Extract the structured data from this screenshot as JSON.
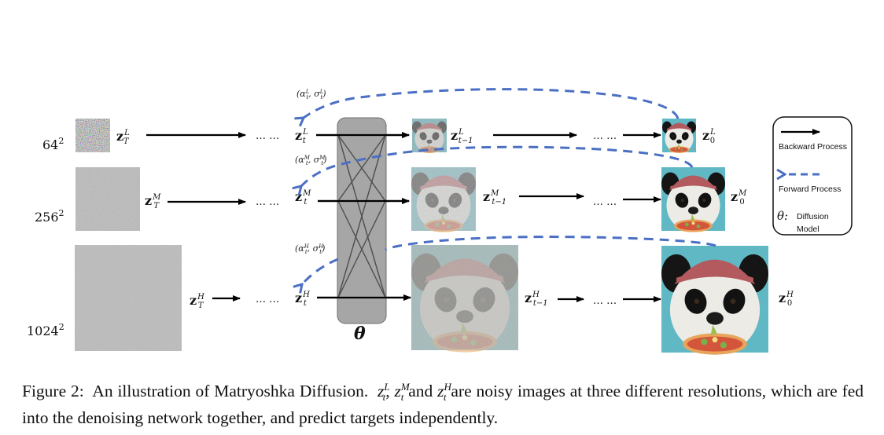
{
  "diagram": {
    "resolutions": [
      {
        "label_base": "64",
        "label_exp": "2",
        "level": "L"
      },
      {
        "label_base": "256",
        "label_exp": "2",
        "level": "M"
      },
      {
        "label_base": "1024",
        "label_exp": "2",
        "level": "H"
      }
    ],
    "rows": [
      {
        "level": "L",
        "z_T": {
          "base": "z",
          "sup": "L",
          "sub": "T"
        },
        "z_t": {
          "base": "z",
          "sup": "L",
          "sub": "t"
        },
        "z_t1": {
          "base": "z",
          "sup": "L",
          "sub": "t−1"
        },
        "z_0": {
          "base": "z",
          "sup": "L",
          "sub": "0"
        },
        "params": "(α_t^L, σ_t^L)",
        "params_parts": {
          "a": "α",
          "a_sup": "L",
          "a_sub": "t",
          "s": "σ",
          "s_sup": "L",
          "s_sub": "t"
        }
      },
      {
        "level": "M",
        "z_T": {
          "base": "z",
          "sup": "M",
          "sub": "T"
        },
        "z_t": {
          "base": "z",
          "sup": "M",
          "sub": "t"
        },
        "z_t1": {
          "base": "z",
          "sup": "M",
          "sub": "t−1"
        },
        "z_0": {
          "base": "z",
          "sup": "M",
          "sub": "0"
        },
        "params": "(α_t^M, σ_t^M)",
        "params_parts": {
          "a": "α",
          "a_sup": "M",
          "a_sub": "t",
          "s": "σ",
          "s_sup": "M",
          "s_sub": "t"
        }
      },
      {
        "level": "H",
        "z_T": {
          "base": "z",
          "sup": "H",
          "sub": "T"
        },
        "z_t": {
          "base": "z",
          "sup": "H",
          "sub": "t"
        },
        "z_t1": {
          "base": "z",
          "sup": "H",
          "sub": "t−1"
        },
        "z_0": {
          "base": "z",
          "sup": "H",
          "sub": "0"
        },
        "params": "(α_t^H, σ_t^H)",
        "params_parts": {
          "a": "α",
          "a_sup": "H",
          "a_sub": "t",
          "s": "σ",
          "s_sup": "H",
          "s_sub": "t"
        }
      }
    ],
    "ellipsis": "… …",
    "network_label": "θ",
    "images": {
      "noise": "pure noise",
      "partially_denoised": "noisy panda wearing red beanie eating pizza",
      "clean": "panda wearing red beanie eating pizza"
    },
    "legend": {
      "backward_label": "Backward Process",
      "forward_label": "Forward Process",
      "theta_symbol": "θ:",
      "theta_label_line1": "Diffusion",
      "theta_label_line2": "Model"
    },
    "colors": {
      "forward_arrow": "#4a6fc4",
      "backward_arrow": "#000000",
      "network_fill": "#a6a6a6",
      "network_lines": "#4d4d4d"
    }
  },
  "caption": {
    "figure_label": "Figure 2:",
    "text_part1": "An illustration of Matryoshka Diffusion.",
    "z1_sup": "L",
    "z2_sup": "M",
    "z3_sup": "H",
    "z_sub": "t",
    "z_base": "z",
    "sep1": ",",
    "and": "and",
    "text_part2": "are noisy images at three different resolutions, which are fed into the denoising network together, and predict targets independently."
  }
}
